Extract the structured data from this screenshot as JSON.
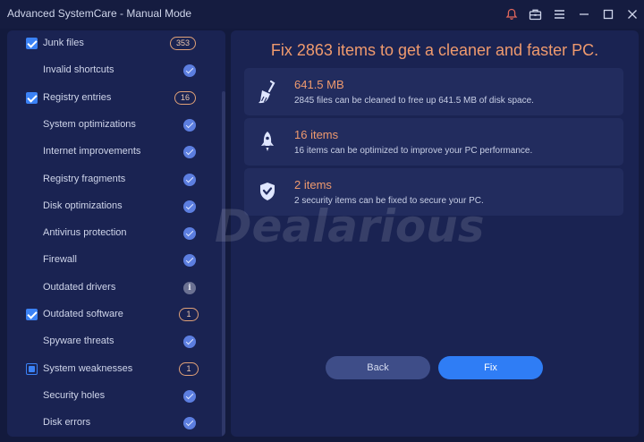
{
  "window": {
    "title": "Advanced SystemCare - Manual Mode",
    "controls": [
      "bell-icon",
      "toolbox-icon",
      "menu-icon",
      "minimize-icon",
      "maximize-icon",
      "close-icon"
    ]
  },
  "sidebar": {
    "items": [
      {
        "label": "Junk files",
        "state": "checked",
        "badge": "353"
      },
      {
        "label": "Invalid shortcuts",
        "state": "ok"
      },
      {
        "label": "Registry entries",
        "state": "checked",
        "badge": "16"
      },
      {
        "label": "System optimizations",
        "state": "ok"
      },
      {
        "label": "Internet improvements",
        "state": "ok"
      },
      {
        "label": "Registry fragments",
        "state": "ok"
      },
      {
        "label": "Disk optimizations",
        "state": "ok"
      },
      {
        "label": "Antivirus protection",
        "state": "ok"
      },
      {
        "label": "Firewall",
        "state": "ok"
      },
      {
        "label": "Outdated drivers",
        "state": "info"
      },
      {
        "label": "Outdated software",
        "state": "checked",
        "badge": "1"
      },
      {
        "label": "Spyware threats",
        "state": "ok"
      },
      {
        "label": "System weaknesses",
        "state": "partial",
        "badge": "1"
      },
      {
        "label": "Security holes",
        "state": "ok"
      },
      {
        "label": "Disk errors",
        "state": "ok"
      }
    ]
  },
  "main": {
    "headline": "Fix 2863 items to get a cleaner and faster PC.",
    "cards": [
      {
        "icon": "broom-icon",
        "title": "641.5 MB",
        "desc": "2845 files can be cleaned to free up 641.5 MB of disk space."
      },
      {
        "icon": "rocket-icon",
        "title": "16 items",
        "desc": "16 items can be optimized to improve your PC performance."
      },
      {
        "icon": "shield-icon",
        "title": "2 items",
        "desc": "2 security items can be fixed to secure your PC."
      }
    ],
    "back_label": "Back",
    "fix_label": "Fix"
  },
  "watermark": "Dealarious",
  "colors": {
    "accent": "#2f7df5",
    "highlight": "#ef9a6e",
    "panel": "#1a2352",
    "background": "#131a3d"
  }
}
